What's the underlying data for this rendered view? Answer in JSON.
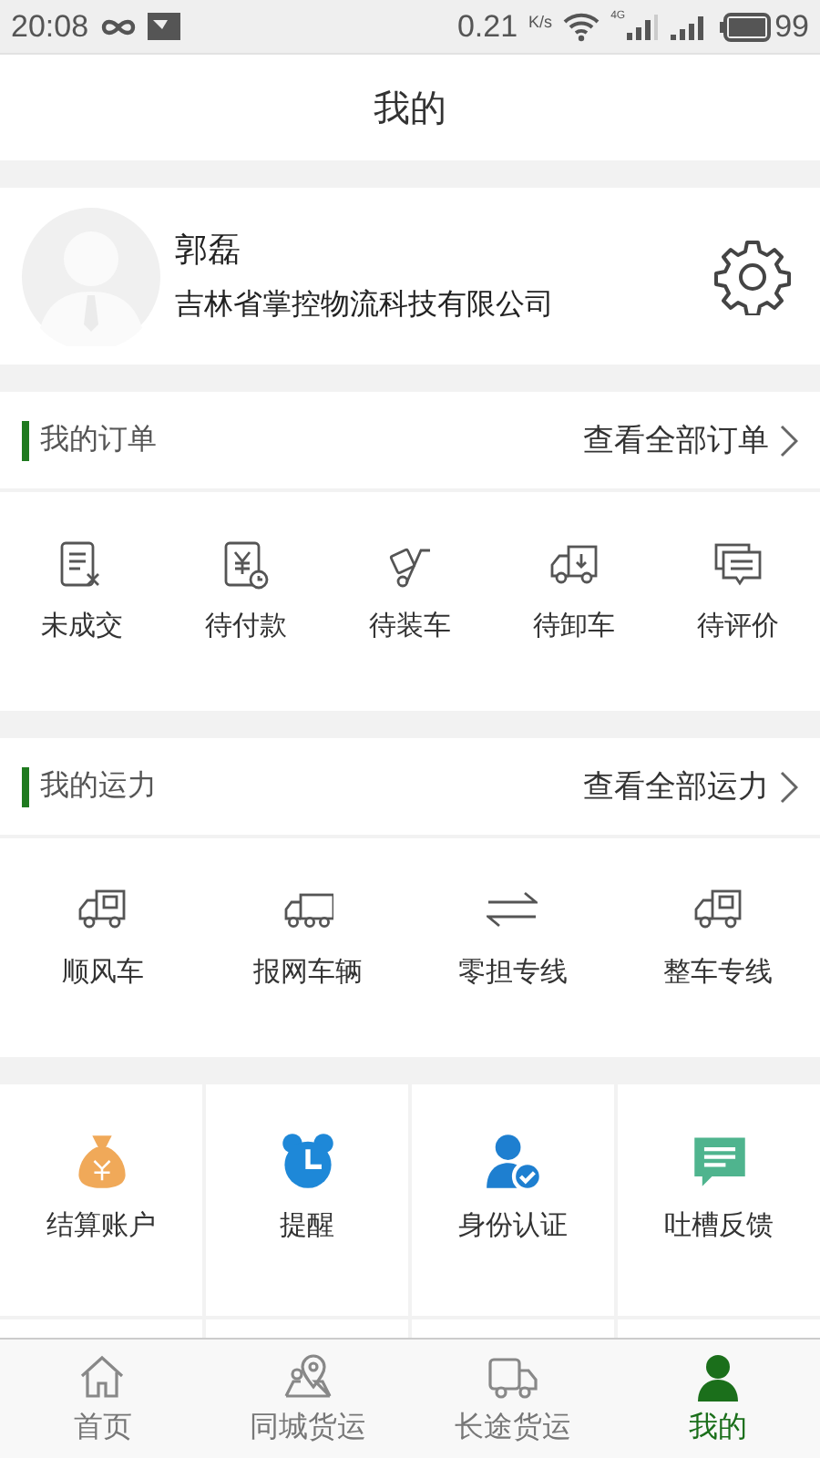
{
  "status_bar": {
    "time": "20:08",
    "speed": "0.21",
    "speed_unit": "K/s",
    "network": "4G",
    "battery": "99"
  },
  "header": {
    "title": "我的"
  },
  "profile": {
    "name": "郭磊",
    "company": "吉林省掌控物流科技有限公司"
  },
  "orders": {
    "title": "我的订单",
    "link": "查看全部订单",
    "items": [
      {
        "label": "未成交"
      },
      {
        "label": "待付款"
      },
      {
        "label": "待装车"
      },
      {
        "label": "待卸车"
      },
      {
        "label": "待评价"
      }
    ]
  },
  "capacity": {
    "title": "我的运力",
    "link": "查看全部运力",
    "items": [
      {
        "label": "顺风车"
      },
      {
        "label": "报网车辆"
      },
      {
        "label": "零担专线"
      },
      {
        "label": "整车专线"
      }
    ]
  },
  "tools": [
    {
      "label": "结算账户",
      "color": "#f0a959"
    },
    {
      "label": "提醒",
      "color": "#1e88d8"
    },
    {
      "label": "身份认证",
      "color": "#1e7fd0"
    },
    {
      "label": "吐槽反馈",
      "color": "#4fb48e"
    }
  ],
  "tab_bar": [
    {
      "label": "首页",
      "selected": false
    },
    {
      "label": "同城货运",
      "selected": false
    },
    {
      "label": "长途货运",
      "selected": false
    },
    {
      "label": "我的",
      "selected": true
    }
  ]
}
